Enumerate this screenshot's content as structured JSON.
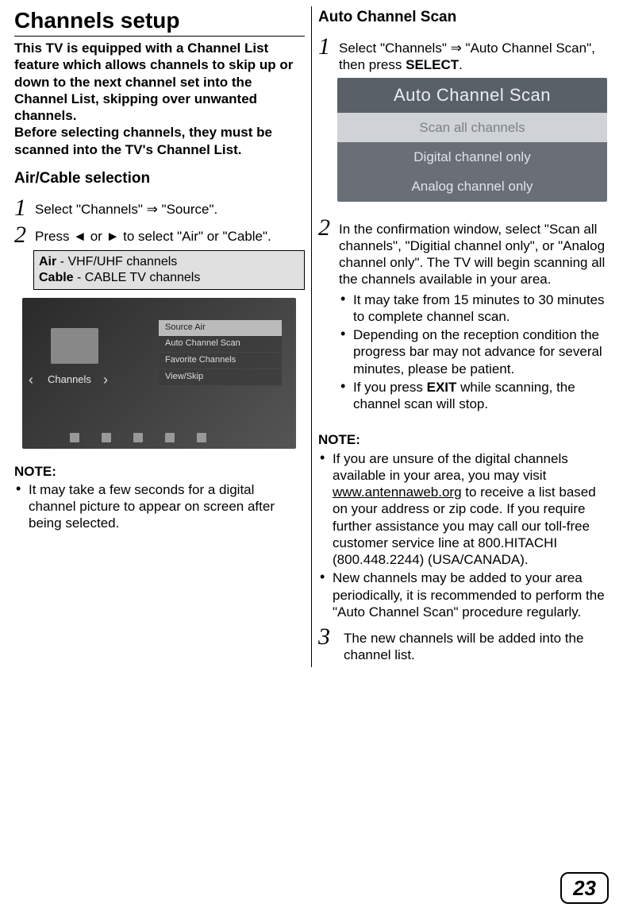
{
  "left": {
    "title": "Channels setup",
    "intro": "This TV is equipped with a Channel List feature which allows channels to skip up or down to the next channel set into the Channel List, skipping over unwanted channels.\nBefore selecting channels, they must be scanned into the TV's Channel List.",
    "sub1": "Air/Cable selection",
    "step1": "Select \"Channels\" ⇒ \"Source\".",
    "step2": "Press ◄ or ► to select \"Air\" or \"Cable\".",
    "infobox_air": "Air",
    "infobox_air_desc": " - VHF/UHF channels",
    "infobox_cable": "Cable",
    "infobox_cable_desc": " - CABLE TV channels",
    "tv": {
      "row1": "Source Air",
      "row2": "Auto Channel Scan",
      "row3": "Favorite Channels",
      "row4": "View/Skip",
      "label": "Channels"
    },
    "note_h": "NOTE:",
    "note1": "It may take a few seconds for a digital channel picture to appear on screen after being selected."
  },
  "right": {
    "sub1": "Auto Channel Scan",
    "step1_a": "Select \"Channels\" ⇒ \"Auto Channel Scan\", then press ",
    "step1_b": "SELECT",
    "step1_c": ".",
    "scan": {
      "title": "Auto Channel Scan",
      "row1": "Scan all channels",
      "row2": "Digital channel only",
      "row3": "Analog channel only"
    },
    "step2_a": "In the confirmation window, select \"Scan all channels\", \"Digitial channel only\", or \"Analog channel only\".  The TV will begin scanning all the channels available in your area.",
    "step2_b1": "It may take from 15 minutes to 30 minutes to complete channel scan.",
    "step2_b2": "Depending on the reception condition the progress bar may not advance for several minutes, please be patient.",
    "step2_b3_a": "If you press ",
    "step2_b3_b": "EXIT",
    "step2_b3_c": " while scanning, the channel scan will stop.",
    "note_h": "NOTE:",
    "note1_a": "If you are unsure of the digital channels available in your area, you may visit ",
    "note1_link": "www.antennaweb.org",
    "note1_b": " to receive a list based on your address or zip code. If you require further assistance you may call our toll-free customer service line at 800.HITACHI (800.448.2244) (USA/CANADA).",
    "note2": "New channels may be added to your area periodically, it is recommended to perform the \"Auto Channel Scan\" procedure regularly.",
    "step3": "The new channels will be added into the channel list."
  },
  "page_number": "23"
}
